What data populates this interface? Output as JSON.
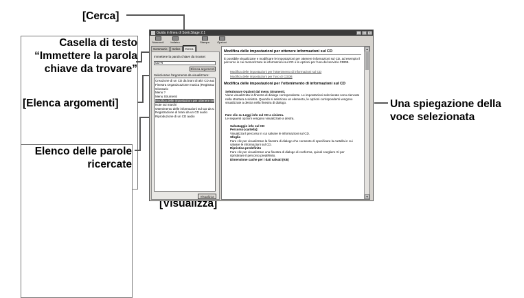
{
  "callouts": {
    "cerca": "[Cerca]",
    "casella_line1": "Casella di testo",
    "casella_line2": "“Immettere la parola",
    "casella_line3": "chiave da trovare”",
    "elenca": "[Elenca argomenti]",
    "elenco_line1": "Elenco delle parole",
    "elenco_line2": "ricercate",
    "spiegazione_line1": "Una spiegazione della",
    "spiegazione_line2": "voce selezionata",
    "visualizza": "[Visualizza]"
  },
  "window": {
    "title": "Guida in linea di SonicStage 2.1",
    "controls": [
      "_",
      "□",
      "×"
    ]
  },
  "toolbar": [
    {
      "label": "Nascondi",
      "icon": "hide-icon"
    },
    {
      "label": "Indietro",
      "icon": "back-arrow-icon"
    },
    {
      "label": "Stampa",
      "icon": "print-icon"
    },
    {
      "label": "Opzioni",
      "icon": "options-icon"
    }
  ],
  "tabs": [
    "Sommario",
    "Indice",
    "Cerca"
  ],
  "left": {
    "prompt": "Immettere la parola chiave da trovare:",
    "keyword": "CD-R",
    "list_button": "Elenca argomenti",
    "topic_prompt": "Selezionare l'argomento da visualizzare:",
    "topics": [
      "Creazione di un CD da brani di altri CD audio",
      "Finestra Organizzazione musica (Registrazione CD)",
      "Glossario",
      "Menu ?",
      "Menu Strumenti",
      "Modifica delle impostazioni per ottenere info",
      "Note sui marchi",
      "Ottenimento delle informazioni sul CD da CD...",
      "Registrazione di brani da un CD audio",
      "Riproduzione di un CD audio"
    ],
    "selected_index": 5,
    "display_button": "Visualizza"
  },
  "content": {
    "heading": "Modifica delle impostazioni per ottenere informazioni sul CD",
    "intro": "È possibile visualizzare e modificare le impostazioni per ottenere informazioni sul CD, ad esempio il percorso in cui memorizzare le informazioni sul CD o le opzioni per l'uso del servizio CDDB.",
    "link1": "Modifica delle impostazioni per l'ottenimento di informazioni sul CD",
    "link2": "Modifica delle impostazioni per l'uso di CDDB",
    "subheading": "Modifica delle impostazioni per l'ottenimento di informazioni sul CD",
    "step1_title": "Selezionare Opzioni dal menu Strumenti.",
    "step1_body": "Viene visualizzata la finestra di dialogo corrispondente. Le impostazioni selezionate sono elencate nella struttura a sinistra. Quando si seleziona un elemento, le opzioni corrispondenti vengono visualizzate a destra nella finestra di dialogo.",
    "step2_title": "Fare clic su Leggi info sul CD a sinistra.",
    "step2_body": "Le seguenti opzioni vengono visualizzate a destra.",
    "bullet1_title": "Salvataggio info sul CD",
    "bullet1_sub": "Percorso (cartella):",
    "bullet1_body": "Visualizza il percorso in cui salvare le informazioni sul CD.",
    "opt1_title": "Sfoglia",
    "opt1_body": "Fare clic per visualizzare la finestra di dialogo che consente di specificare la cartella in cui salvare le informazioni sul CD.",
    "opt2_title": "Ripristina predefinito",
    "opt2_body": "Fare clic per visualizzare una finestra di dialogo di conferma, quindi scegliere Sì per ripristinare il percorso predefinito.",
    "bullet2_title": "Dimensione cache per i dati salvati (KB)"
  }
}
